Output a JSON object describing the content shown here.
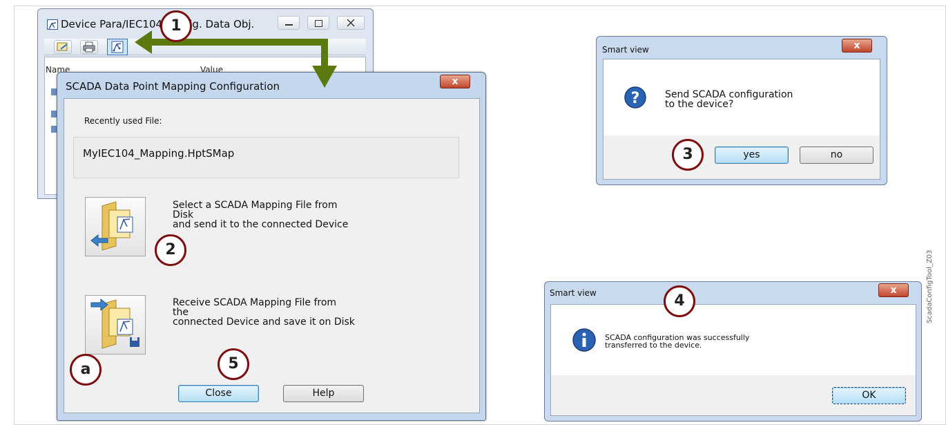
{
  "back_window": {
    "title": "Device Para/IEC104 Config. Data Obj.",
    "col_name": "Name",
    "col_value": "Value",
    "min_icon": "minimize-icon",
    "max_icon": "maximize-icon",
    "close_icon": "close-icon"
  },
  "main_dialog": {
    "title": "SCADA Data Point Mapping Configuration",
    "close_glyph": "x",
    "recent_label": "Recently used File:",
    "recent_file": "MyIEC104_Mapping.HptSMap",
    "send_desc": "Select a SCADA Mapping File from\nDisk\nand send it to the connected Device",
    "receive_desc": "Receive SCADA Mapping File from\nthe\nconnected Device and save it on Disk",
    "close_button": "Close",
    "help_button": "Help"
  },
  "dialog_confirm": {
    "title": "Smart view",
    "close_glyph": "x",
    "message": "Send SCADA configuration\nto the device?",
    "yes": "yes",
    "no": "no",
    "icon": "question-icon"
  },
  "dialog_info": {
    "title": "Smart view",
    "close_glyph": "x",
    "message": "SCADA configuration was successfully\ntransferred to the device.",
    "ok": "OK",
    "icon": "info-icon"
  },
  "badges": {
    "one": "1",
    "two": "2",
    "three": "3",
    "four": "4",
    "five": "5",
    "a": "a"
  },
  "side_note": "ScadaConfigTool_Z03",
  "colors": {
    "arrow": "#5a7a0f",
    "badge_ring": "#7b0f0f"
  }
}
